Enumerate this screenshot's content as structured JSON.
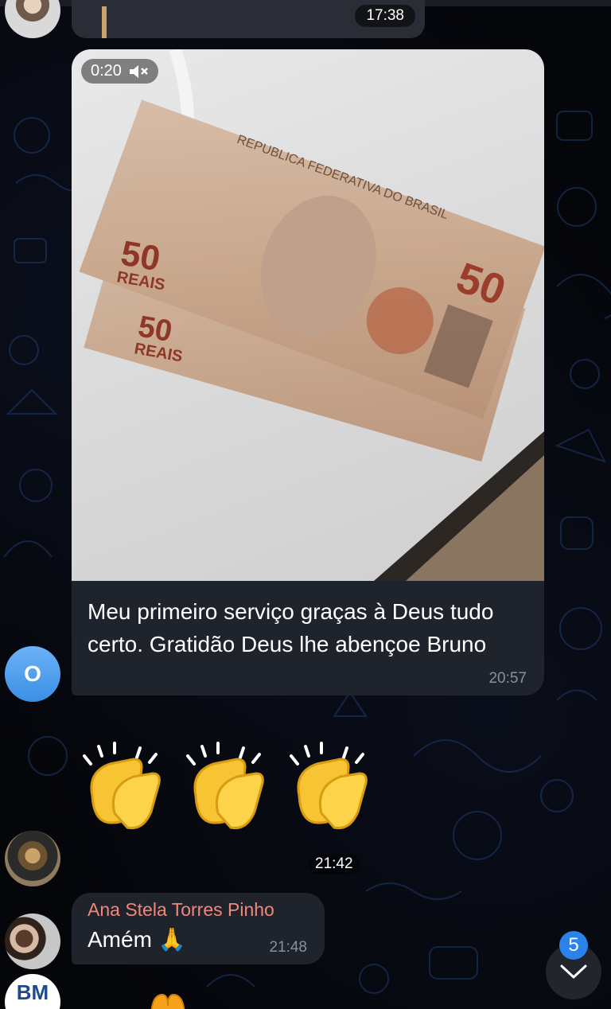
{
  "header": {
    "previous_message_time": "17:38"
  },
  "media_message": {
    "avatar_initial": "O",
    "video_duration": "0:20",
    "muted_icon": "speaker-muted-icon",
    "banknote_text": {
      "issuer": "REPUBLICA FEDERATIVA DO BRASIL",
      "denomination": "50",
      "currency": "REAIS"
    },
    "caption": "Meu primeiro serviço graças à Deus tudo certo.  Gratidão Deus lhe abençoe Bruno",
    "time": "20:57"
  },
  "emoji_message": {
    "emoji": "clapping-hands-icon",
    "count": 3,
    "time": "21:42"
  },
  "text_message": {
    "sender": "Ana Stela Torres Pinho",
    "text": "Amém 🙏",
    "time": "21:48"
  },
  "bottom_avatar_initials": "BM",
  "scroll_button": {
    "unread_count": "5",
    "icon": "chevron-down-icon"
  },
  "colors": {
    "background": "#05060a",
    "bubble": "#1f232b",
    "sender_name": "#f0877c",
    "badge": "#2b82ea",
    "avatar_o": "#4a9cf0"
  }
}
